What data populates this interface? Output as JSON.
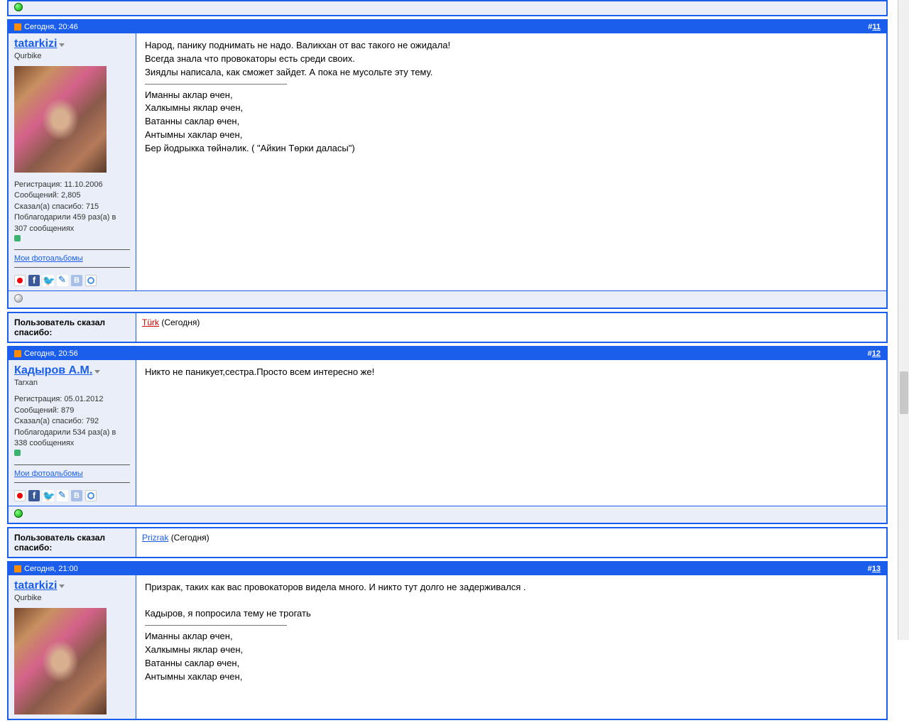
{
  "posts": [
    {
      "date": "Сегодня, 20:46",
      "num": "11",
      "user": {
        "name": "tatarkizi",
        "title": "Qurbike",
        "reg": "Регистрация: 11.10.2006",
        "msgs": "Сообщений: 2,805",
        "thanks_said": "Сказал(а) спасибо: 715",
        "thanks_got": "Поблагодарили 459 раз(а) в 307 сообщениях",
        "photolink": "Мои фотоальбомы",
        "online": false,
        "show_avatar": true
      },
      "content_lines": [
        "Народ, панику поднимать не надо. Валикхан от вас такого не ожидала!",
        "Всегда знала что провокаторы есть среди своих.",
        "Зиядлы написала, как сможет зайдет. А пока не мусольте эту тему."
      ],
      "signature": [
        "Иманны аклар өчен,",
        "Халкымны яклар өчен,",
        "Ватанны саклар өчен,",
        "Антымны хаклар өчен,",
        "Бер йодрыкка төйнәлик. ( \"Айкин Төрки даласы\")"
      ],
      "thanks": {
        "label": "Пользователь сказал cпасибо:",
        "user": "Türk",
        "when": "(Сегодня)",
        "link_class": ""
      }
    },
    {
      "date": "Сегодня, 20:56",
      "num": "12",
      "user": {
        "name": "Кадыров А.М.",
        "title": "Tarxan",
        "reg": "Регистрация: 05.01.2012",
        "msgs": "Сообщений: 879",
        "thanks_said": "Сказал(а) спасибо: 792",
        "thanks_got": "Поблагодарили 534 раз(а) в 338 сообщениях",
        "photolink": "Мои фотоальбомы",
        "online": true,
        "show_avatar": false
      },
      "content_lines": [
        "Никто не паникует,сестра.Просто всем интересно же!"
      ],
      "signature": [],
      "thanks": {
        "label": "Пользователь сказал cпасибо:",
        "user": "Prizrak",
        "when": "(Сегодня)",
        "link_class": "blue"
      }
    },
    {
      "date": "Сегодня, 21:00",
      "num": "13",
      "user": {
        "name": "tatarkizi",
        "title": "Qurbike",
        "reg": "",
        "msgs": "",
        "thanks_said": "",
        "thanks_got": "",
        "photolink": "",
        "online": false,
        "show_avatar": true
      },
      "content_lines": [
        "Призрак, таких как вас провокаторов видела много. И никто тут долго не задерживался .",
        "",
        "Кадыров, я попросила тему не трогать"
      ],
      "signature": [
        "Иманны аклар өчен,",
        "Халкымны яклар өчен,",
        "Ватанны саклар өчен,",
        "Антымны хаклар өчен,"
      ],
      "thanks": null
    }
  ]
}
